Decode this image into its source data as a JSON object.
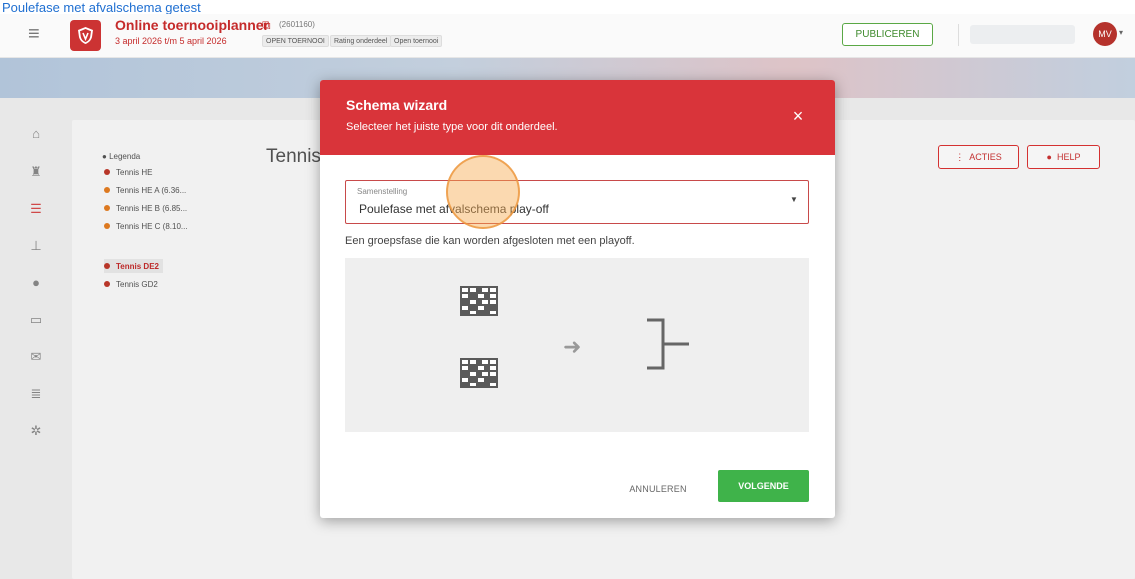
{
  "caption": {
    "text": "Poulefase met afvalschema getest"
  },
  "header": {
    "app_title": "Online toernooiplanner",
    "tournament_id": "(2601160)",
    "dates": "3 april 2026 t/m 5 april 2026",
    "tags": [
      "OPEN TOERNOOI",
      "Rating onderdeel",
      "Open toernooi"
    ],
    "publish_label": "PUBLICEREN",
    "avatar_initials": "MV"
  },
  "legend": {
    "title": "Legenda",
    "items": [
      {
        "label": "Tennis HE",
        "color": "#c0392b"
      },
      {
        "label": "Tennis HE A (6.36...",
        "color": "#e67e22"
      },
      {
        "label": "Tennis HE B (6.85...",
        "color": "#e67e22"
      },
      {
        "label": "Tennis HE C (8.10...",
        "color": "#e67e22"
      },
      {
        "label": "Tennis DE2",
        "color": "#c0392b"
      },
      {
        "label": "Tennis GD2",
        "color": "#c0392b"
      }
    ]
  },
  "main": {
    "heading": "Tennis",
    "acties_label": "ACTIES",
    "help_label": "HELP"
  },
  "modal": {
    "title": "Schema wizard",
    "subtitle": "Selecteer het juiste type voor dit onderdeel.",
    "close_symbol": "×",
    "select_label": "Samenstelling",
    "select_value": "Poulefase met afvalschema play-off",
    "description": "Een groepsfase die kan worden afgesloten met een playoff.",
    "cancel_label": "ANNULEREN",
    "next_label": "VOLGENDE"
  },
  "colors": {
    "header_red": "#d9343a",
    "brand_red": "#c52b2b",
    "green": "#3fb34a"
  }
}
